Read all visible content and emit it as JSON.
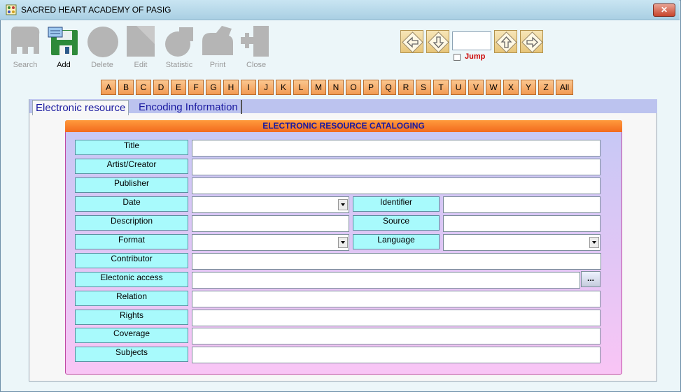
{
  "window": {
    "title": "SACRED HEART ACADEMY OF PASIG",
    "close_symbol": "✕"
  },
  "toolbar": {
    "items": [
      {
        "label": "Search",
        "icon": "search-icon",
        "enabled": false
      },
      {
        "label": "Add",
        "icon": "add-icon",
        "enabled": true
      },
      {
        "label": "Delete",
        "icon": "delete-icon",
        "enabled": false
      },
      {
        "label": "Edit",
        "icon": "edit-icon",
        "enabled": false
      },
      {
        "label": "Statistic",
        "icon": "statistic-icon",
        "enabled": false
      },
      {
        "label": "Print",
        "icon": "print-icon",
        "enabled": false
      },
      {
        "label": "Close",
        "icon": "close-door-icon",
        "enabled": false
      }
    ]
  },
  "navigation": {
    "jump_label": "Jump",
    "jump_value": "",
    "jump_checked": false
  },
  "alphabet": [
    "A",
    "B",
    "C",
    "D",
    "E",
    "F",
    "G",
    "H",
    "I",
    "J",
    "K",
    "L",
    "M",
    "N",
    "O",
    "P",
    "Q",
    "R",
    "S",
    "T",
    "U",
    "V",
    "W",
    "X",
    "Y",
    "Z",
    "All"
  ],
  "tabs": [
    {
      "label": "Electronic resource",
      "active": true
    },
    {
      "label": "Encoding Information",
      "active": false
    }
  ],
  "form": {
    "header": "ELECTRONIC RESOURCE CATALOGING",
    "labels": {
      "title": "Title",
      "artist": "Artist/Creator",
      "publisher": "Publisher",
      "date": "Date",
      "identifier": "Identifier",
      "description": "Description",
      "source": "Source",
      "format": "Format",
      "language": "Language",
      "contributor": "Contributor",
      "access": "Electonic access",
      "relation": "Relation",
      "rights": "Rights",
      "coverage": "Coverage",
      "subjects": "Subjects"
    },
    "values": {
      "title": "",
      "artist": "",
      "publisher": "",
      "date": "",
      "identifier": "",
      "description": "",
      "source": "",
      "format": "",
      "language": "",
      "contributor": "",
      "access": "",
      "relation": "",
      "rights": "",
      "coverage": "",
      "subjects": ""
    },
    "browse_label": "..."
  },
  "colors": {
    "accent_orange": "#f26a1e",
    "label_cyan": "#a8fafc",
    "tab_text": "#1a1aa0",
    "jump_red": "#cc0000"
  }
}
